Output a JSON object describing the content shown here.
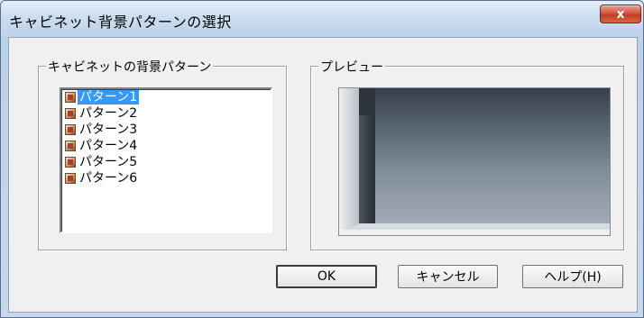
{
  "window": {
    "title": "キャビネット背景パターンの選択",
    "close_label": "x"
  },
  "pattern_group": {
    "label": "キャビネットの背景パターン",
    "items": [
      {
        "label": "パターン1",
        "selected": true
      },
      {
        "label": "パターン2",
        "selected": false
      },
      {
        "label": "パターン3",
        "selected": false
      },
      {
        "label": "パターン4",
        "selected": false
      },
      {
        "label": "パターン5",
        "selected": false
      },
      {
        "label": "パターン6",
        "selected": false
      }
    ]
  },
  "preview_group": {
    "label": "プレビュー"
  },
  "buttons": {
    "ok_label": "OK",
    "cancel_label": "キャンセル",
    "help_label": "ヘルプ(H)"
  },
  "colors": {
    "selection": "#3399ff",
    "close_button": "#c23c22"
  }
}
